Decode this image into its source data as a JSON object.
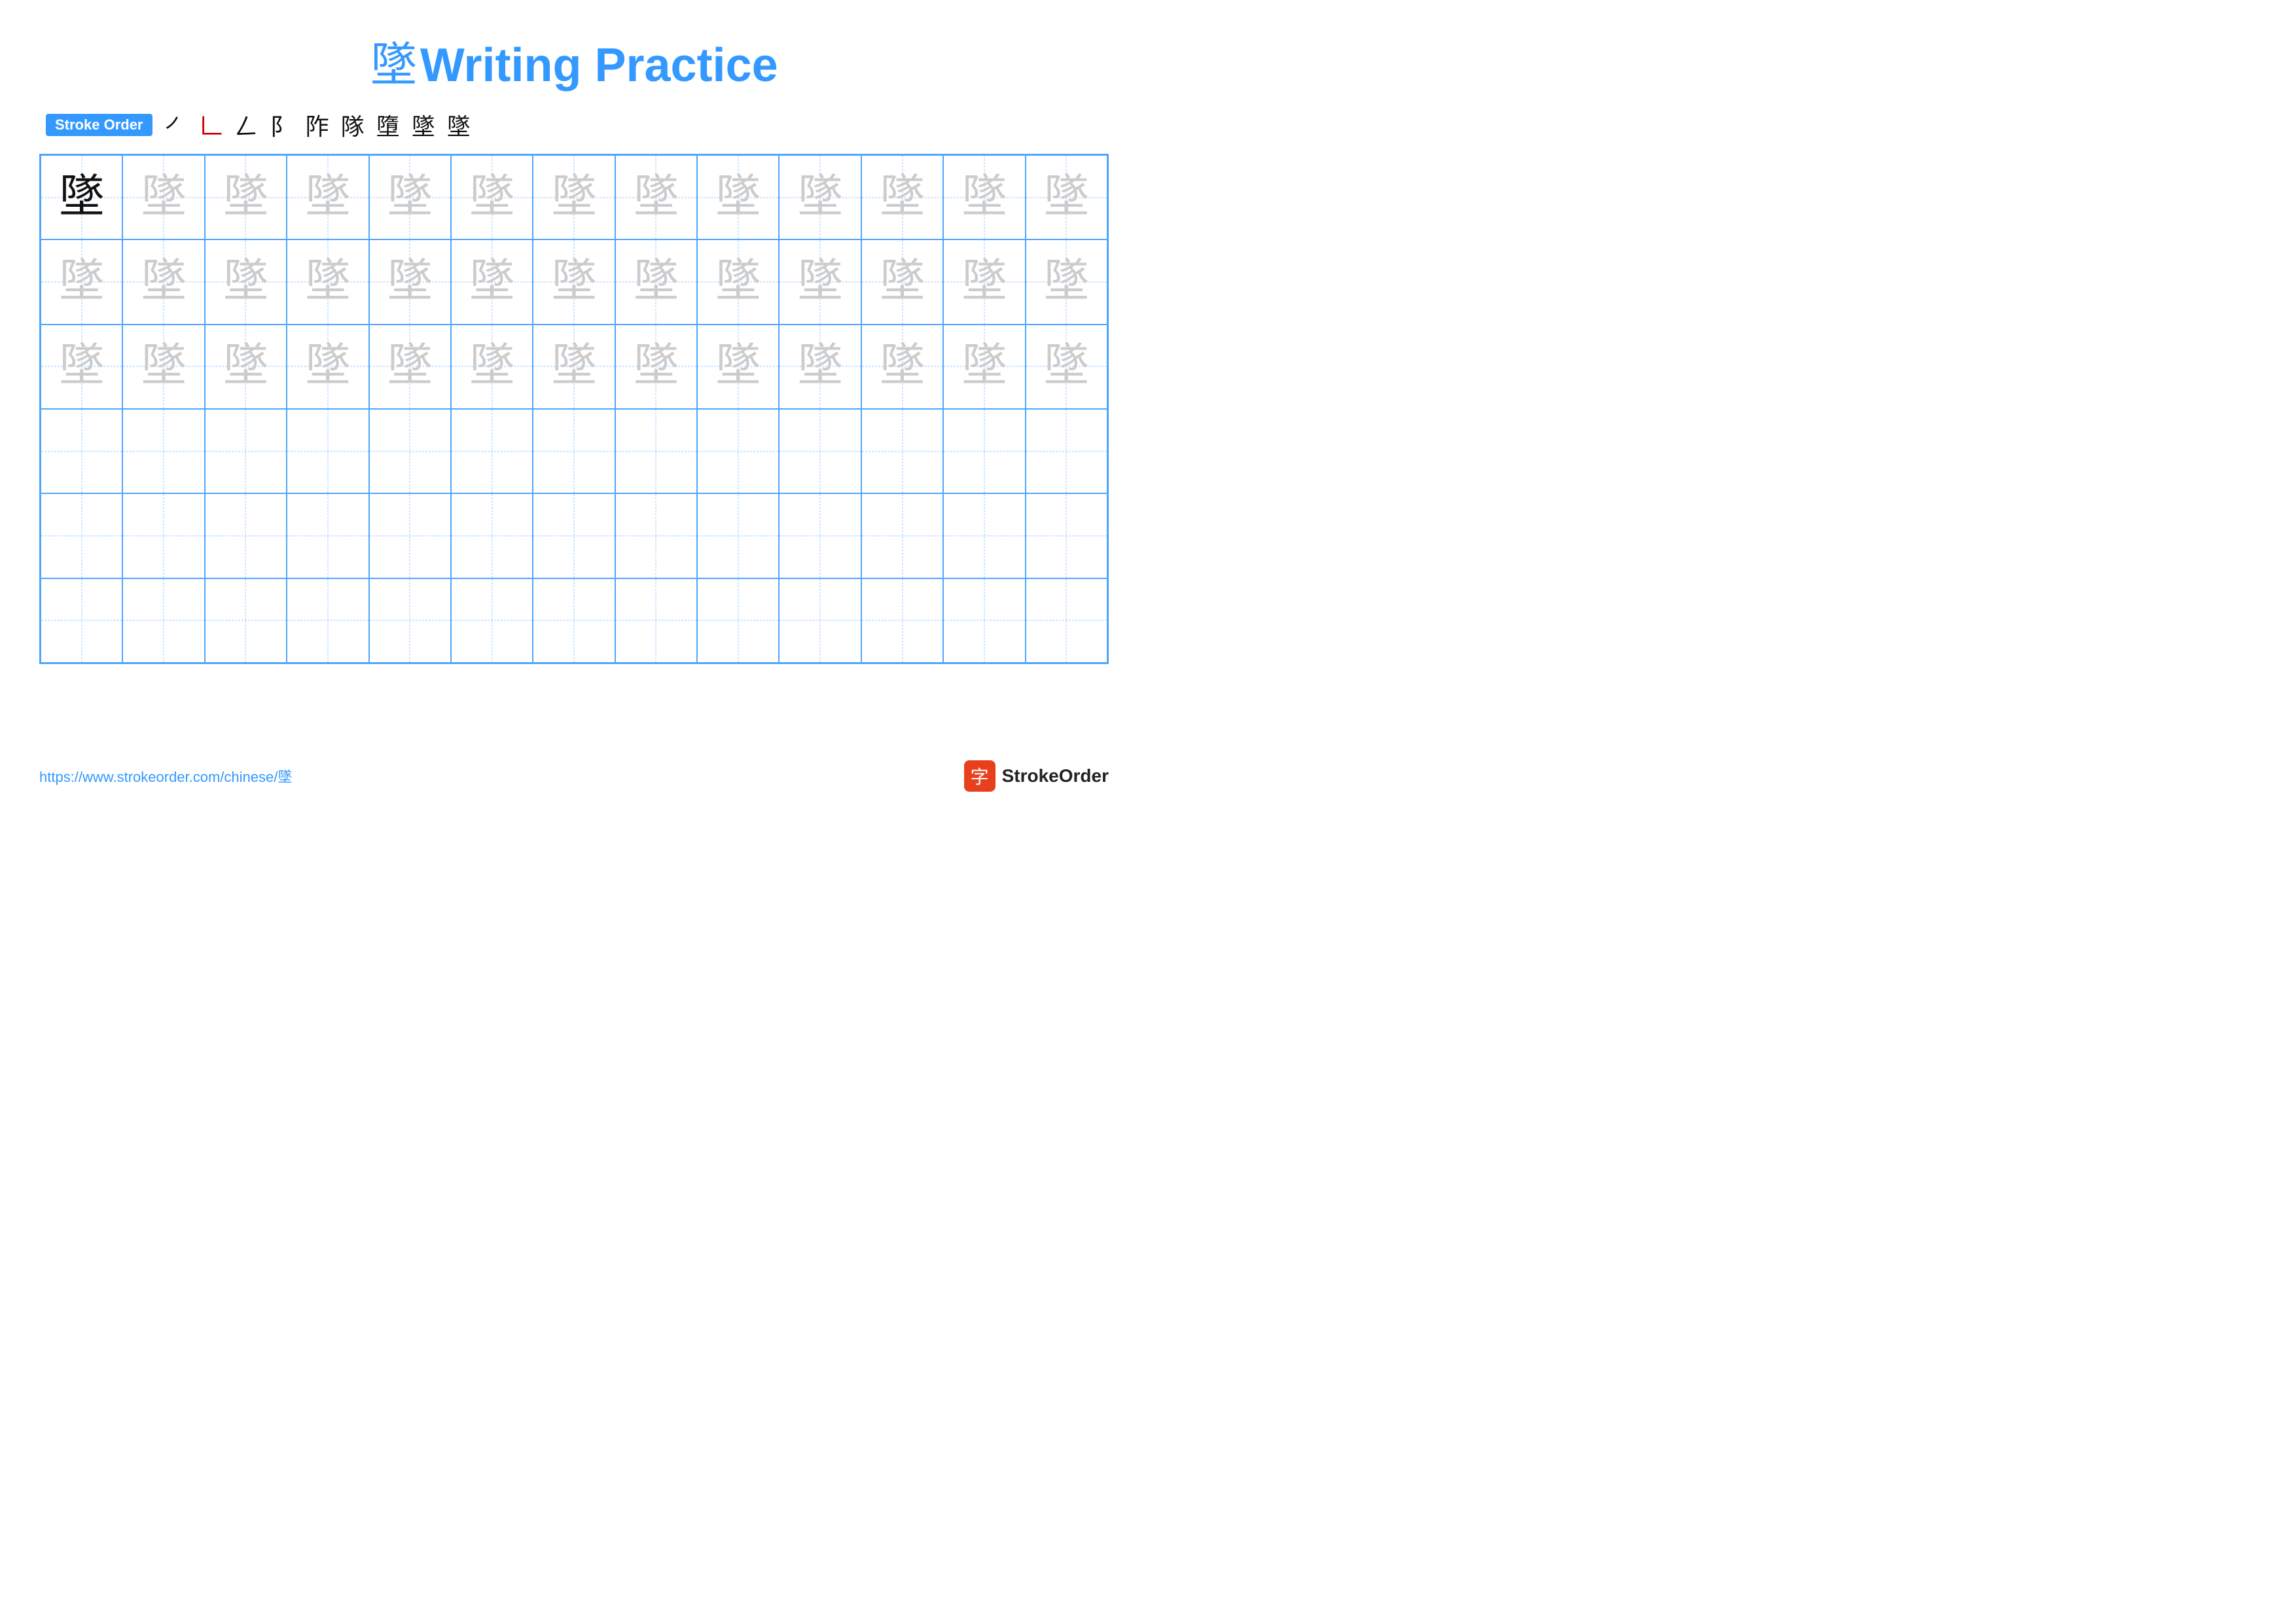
{
  "title": {
    "char": "墜",
    "label": "Writing Practice"
  },
  "stroke_order": {
    "badge_label": "Stroke Order",
    "steps": [
      "㇒",
      "㇓",
      "㇓⁻",
      "㇓㇏",
      "㇓㇏⁻",
      "㇓㇏⁻⁻",
      "㇓㇏⁻⁻⁻",
      "墜⁻",
      "墜"
    ]
  },
  "grid": {
    "cols": 13,
    "rows": 6,
    "char": "墜",
    "dark_count": 1,
    "light_rows": [
      1,
      2
    ],
    "empty_rows": [
      3,
      4,
      5
    ]
  },
  "footer": {
    "url": "https://www.strokeorder.com/chinese/墜",
    "logo_icon": "字",
    "logo_text": "StrokeOrder"
  }
}
